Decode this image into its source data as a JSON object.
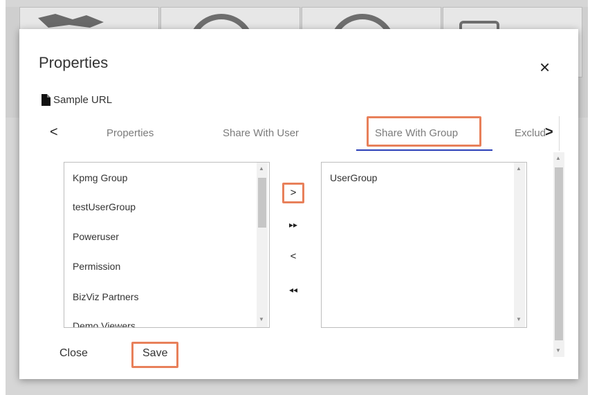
{
  "modal": {
    "title": "Properties",
    "close_glyph": "×",
    "file_icon": "document-icon",
    "file_name": "Sample URL"
  },
  "tabs": {
    "prev_glyph": "<",
    "next_glyph": ">",
    "items": [
      {
        "label": "Properties"
      },
      {
        "label": "Share With User"
      },
      {
        "label": "Share With Group",
        "active": true
      },
      {
        "label": "Exclud"
      }
    ],
    "highlight_color": "#e8805a",
    "underline_color": "#2b3fb8"
  },
  "available_groups": {
    "items": [
      "Kpmg Group",
      "testUserGroup",
      "Poweruser",
      "Permission",
      "BizViz Partners",
      "Demo Viewers"
    ]
  },
  "selected_groups": {
    "items": [
      "UserGroup"
    ]
  },
  "move_buttons": {
    "move_right": ">",
    "move_all_right": "▸▸",
    "move_left": "<",
    "move_all_left": "◂◂"
  },
  "footer": {
    "close_label": "Close",
    "save_label": "Save"
  }
}
